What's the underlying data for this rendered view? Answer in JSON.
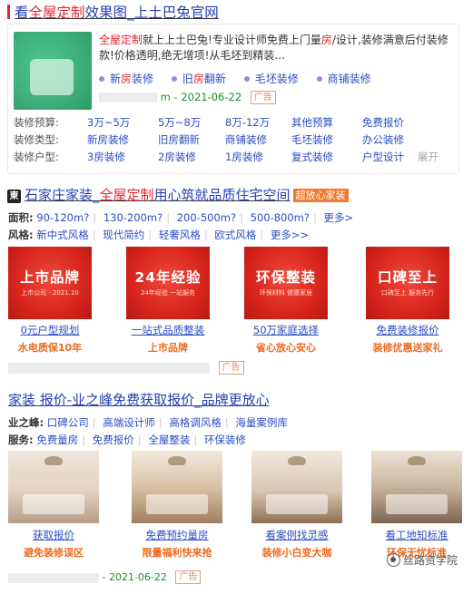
{
  "ad1": {
    "title_part1": "看",
    "title_part2": "全屋定制",
    "title_part3": "效果图_上土巴兔官网",
    "desc_hl1": "全屋定制",
    "desc_text1": "就上上土巴兔!专业设计师免费上门量",
    "desc_hl2": "房",
    "desc_text2": "/设计,装修满意后付装修款!价格透明,绝无增项!从毛坯到精装...",
    "sub_links": [
      {
        "pre": "新",
        "hl": "房",
        "post": "装修"
      },
      {
        "pre": "旧",
        "hl": "房",
        "post": "翻新"
      },
      {
        "pre": "毛坯装修",
        "hl": "",
        "post": ""
      },
      {
        "pre": "商铺装修",
        "hl": "",
        "post": ""
      }
    ],
    "domain_visible": "m",
    "date": " - 2021-06-22",
    "badge": "广告",
    "grid": [
      {
        "label": "装修预算:",
        "items": [
          "3万~5万",
          "5万~8万",
          "8万-12万",
          "其他预算",
          "免费报价"
        ]
      },
      {
        "label": "装修类型:",
        "items": [
          "新房装修",
          "旧房翻新",
          "商铺装修",
          "毛坯装修",
          "办公装修"
        ]
      },
      {
        "label": "装修户型:",
        "items": [
          "3房装修",
          "2房装修",
          "1房装修",
          "复式装修",
          "户型设计"
        ]
      }
    ],
    "expand_label": "展开",
    "expand_icon": "chevron-down-icon"
  },
  "ad2": {
    "icon_text": "東",
    "title_pre": "石家庄家装_",
    "title_hl": "全屋定制",
    "title_post": "用心筑就品质住宅空间",
    "tag": "超放心家装",
    "filters": [
      {
        "label": "面积:",
        "items": [
          "90-120m?",
          "130-200m?",
          "200-500m?",
          "500-800m?",
          "更多>"
        ]
      },
      {
        "label": "风格:",
        "items": [
          "新中式风格",
          "现代简约",
          "轻奢风格",
          "欧式风格",
          "更多>>"
        ]
      }
    ],
    "tiles": [
      {
        "big": "上市品牌",
        "small": "上市公司 · 2021.10",
        "caption": "0元户型规划",
        "sub": "水电质保10年"
      },
      {
        "big": "24年经验",
        "small": "24年经验 一站服务",
        "caption": "一站式品质整装",
        "sub": "上市品牌"
      },
      {
        "big": "环保整装",
        "small": "环保材料 健康家居",
        "caption": "50万家庭选择",
        "sub": "省心放心安心"
      },
      {
        "big": "口碑至上",
        "small": "口碑至上 服务先行",
        "caption": "免费装修报价",
        "sub": "装修优惠送家礼"
      }
    ],
    "badge": "广告"
  },
  "ad3": {
    "title": "家装 报价-业之峰免费获取报价_品牌更放心",
    "filters": [
      {
        "label": "业之峰:",
        "items": [
          "口碑公司",
          "高端设计师",
          "高格调风格",
          "海量案例库"
        ]
      },
      {
        "label": "服务:",
        "items": [
          "免费量房",
          "免费报价",
          "全屋整装",
          "环保装修"
        ]
      }
    ],
    "tiles": [
      {
        "caption": "获取报价",
        "sub": "避免装修误区"
      },
      {
        "caption": "免费预约量房",
        "sub": "限量福利快来抢"
      },
      {
        "caption": "看案例找灵感",
        "sub": "装修小白变大咖"
      },
      {
        "caption": "看工地知标准",
        "sub": "环保无忧标准"
      }
    ],
    "date": " - 2021-06-22",
    "badge": "广告"
  },
  "watermark": {
    "text": "丝路资学院",
    "icon": "wechat-official-icon"
  },
  "colors": {
    "title_blue": "#2440b3",
    "highlight_red": "#e3262d",
    "link_blue": "#2b4ec4",
    "url_green": "#1a8d2a",
    "accent_orange": "#f06a1e"
  }
}
